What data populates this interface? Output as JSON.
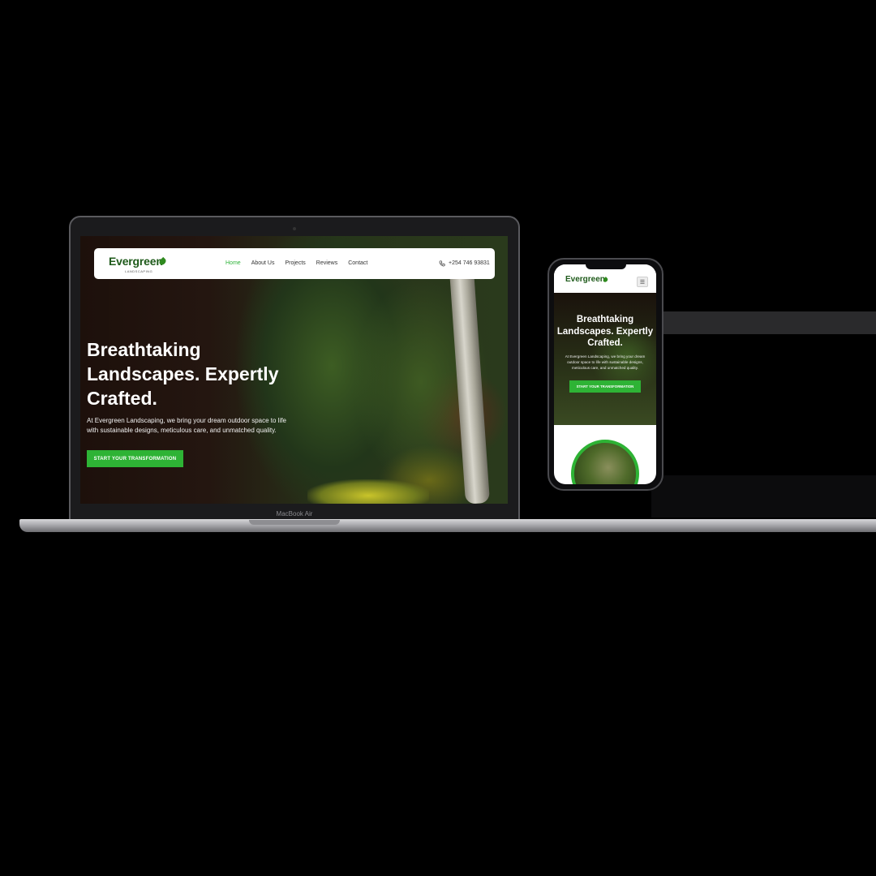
{
  "laptop": {
    "model_label": "MacBook Air",
    "nav": {
      "logo": "Evergreen",
      "logo_sub": "LANDSCAPING",
      "links": [
        "Home",
        "About Us",
        "Projects",
        "Reviews",
        "Contact"
      ],
      "active_link": "Home",
      "phone": "+254 746 93831"
    },
    "hero": {
      "title": "Breathtaking Landscapes. Expertly Crafted.",
      "text": "At Evergreen Landscaping, we bring your dream outdoor space to life with sustainable designs, meticulous care, and unmatched quality.",
      "cta": "START YOUR TRANSFORMATION"
    }
  },
  "phone": {
    "logo": "Evergreen",
    "menu_icon": "hamburger-icon",
    "hero": {
      "title": "Breathtaking Landscapes. Expertly Crafted.",
      "text": "At Evergreen Landscaping, we bring your dream outdoor space to life with sustainable designs, meticulous care, and unmatched quality.",
      "cta": "START YOUR TRANSFORMATION"
    }
  },
  "colors": {
    "brand_green": "#1e5a1a",
    "accent_green": "#2eb335"
  }
}
